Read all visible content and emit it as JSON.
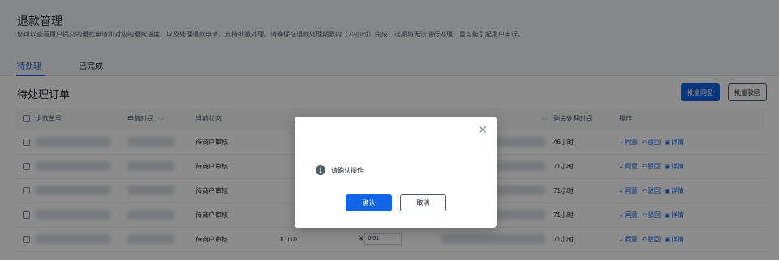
{
  "header": {
    "title": "退款管理",
    "description": "您可以查看用户提交的退款申请和对应的退款进度，以及处理退款申请，支持批量处理。请确保在退款处理期限内（72小时）完成，过期将无法进行处理，且可能引起用户申诉。"
  },
  "tabs": [
    {
      "label": "待处理",
      "active": true
    },
    {
      "label": "已完成",
      "active": false
    }
  ],
  "section": {
    "title": "待处理订单",
    "batch_approve_label": "批量同意",
    "batch_reject_label": "批量驳回"
  },
  "table": {
    "columns": [
      "退款单号",
      "申请时间",
      "当前状态",
      "",
      "",
      "",
      "剩余处理时间",
      "操作"
    ],
    "rows": [
      {
        "status": "待商户审核",
        "amount": "",
        "refund_input": "",
        "remaining": "46小时"
      },
      {
        "status": "待商户审核",
        "amount": "",
        "refund_input": "",
        "remaining": "71小时"
      },
      {
        "status": "待商户审核",
        "amount": "",
        "refund_input": "",
        "remaining": "71小时"
      },
      {
        "status": "待商户审核",
        "amount": "",
        "refund_input": "",
        "remaining": "71小时"
      },
      {
        "status": "待商户审核",
        "amount": "¥ 0.01",
        "currency": "¥",
        "refund_input": "0.01",
        "remaining": "71小时"
      }
    ],
    "actions": {
      "approve": "同意",
      "reject": "驳回",
      "detail": "详情"
    }
  },
  "dialog": {
    "message": "请确认操作",
    "ok_label": "确认",
    "cancel_label": "取消"
  },
  "colors": {
    "accent": "#1264e6",
    "mask": "rgba(0,0,0,0.45)"
  }
}
